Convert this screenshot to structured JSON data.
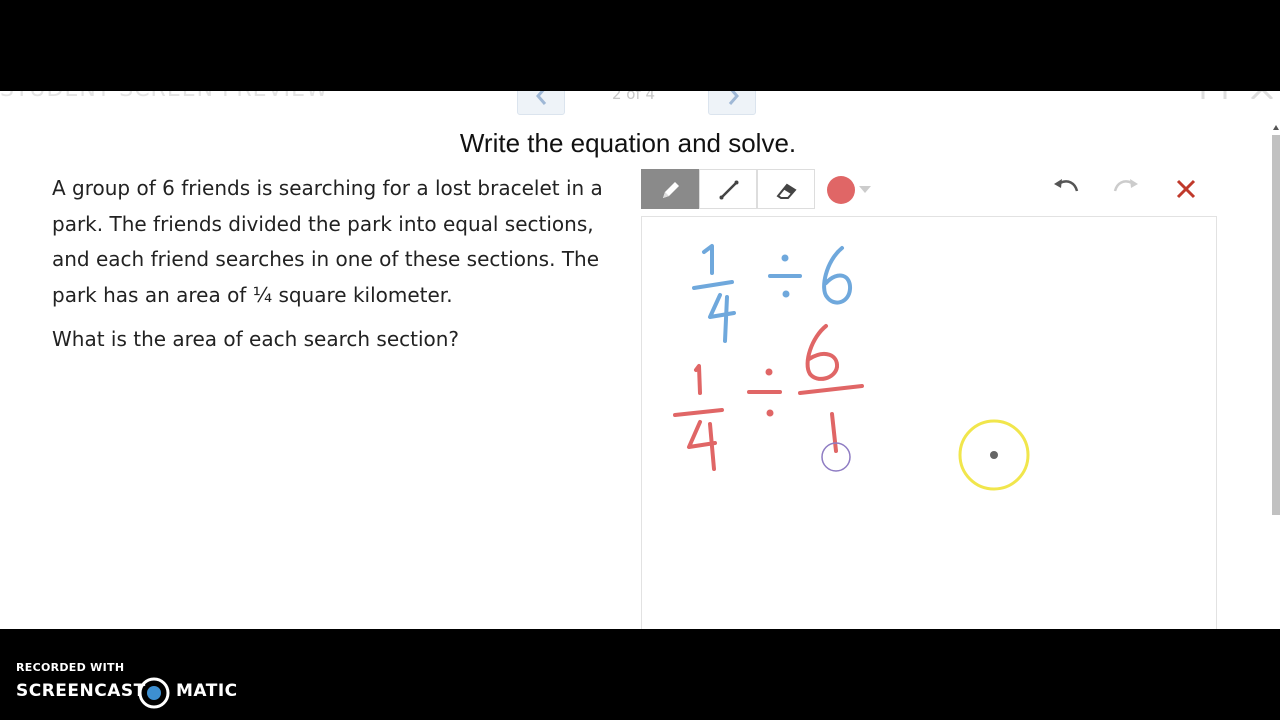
{
  "header": {
    "preview_label": "STUDENT SCREEN PREVIEW",
    "page_indicator": "2 of 4"
  },
  "title": "Write the equation and solve.",
  "prompt": {
    "paragraph": "A group of 6 friends is searching for a lost bracelet in a park.  The friends divided the park into equal sections, and each friend searches in one of these sections.  The park has an area of ¼ square kilometer.",
    "question": "What is the area of each search section?"
  },
  "toolbar": {
    "tools": [
      "pencil-icon",
      "line-icon",
      "eraser-icon"
    ],
    "active_tool": "pencil",
    "selected_color": "#e06666"
  },
  "sketch": {
    "line1": {
      "numerator": "1",
      "denominator": "4",
      "operator": "÷",
      "divisor": "6",
      "color": "#6fa8dc"
    },
    "line2": {
      "numerator": "1",
      "denominator": "4",
      "operator": "÷",
      "divisor_numerator": "6",
      "divisor_denominator": "1",
      "color": "#e06666"
    }
  },
  "footer": {
    "recorded_with": "RECORDED WITH",
    "brand_left": "SCREENCAST",
    "brand_right": "MATIC"
  }
}
